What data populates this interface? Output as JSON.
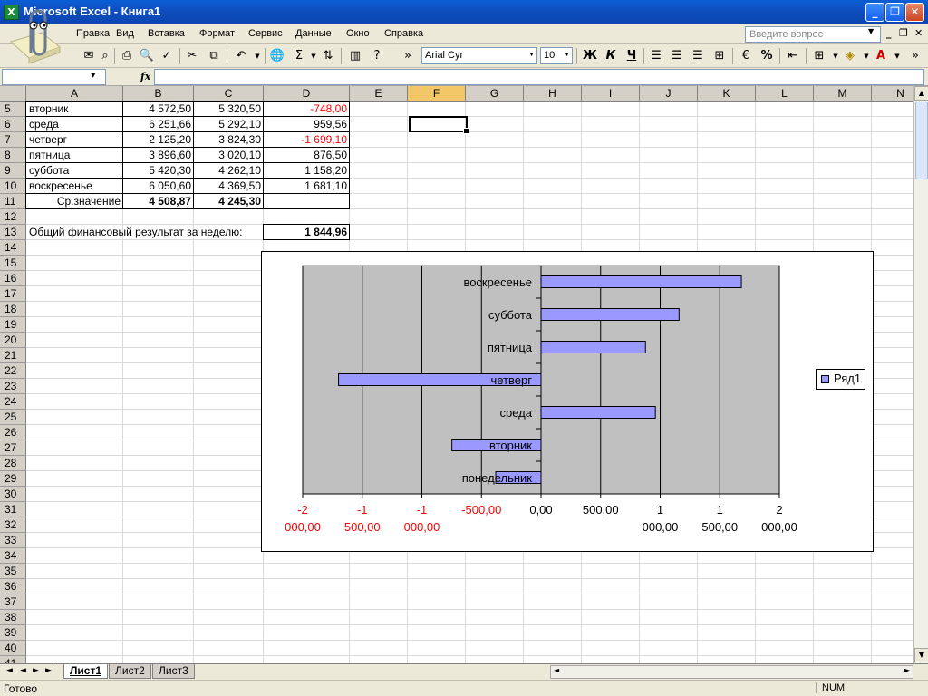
{
  "window": {
    "title": "Microsoft Excel - Книга1",
    "minimize": "_",
    "restore": "❐",
    "close": "✕"
  },
  "menu": {
    "items": [
      "Правка",
      "Вид",
      "Вставка",
      "Формат",
      "Сервис",
      "Данные",
      "Окно",
      "Справка"
    ],
    "ask_placeholder": "Введите вопрос"
  },
  "toolbar": {
    "font": "Arial Cyr",
    "size": "10",
    "bold": "Ж",
    "italic": "К",
    "underline": "Ч",
    "percent": "%"
  },
  "formula_bar": {
    "fx": "fx",
    "name_box": "",
    "content": ""
  },
  "columns": [
    "A",
    "B",
    "C",
    "D",
    "E",
    "F",
    "G",
    "H",
    "I",
    "J",
    "K",
    "L",
    "M",
    "N"
  ],
  "selected_column": "F",
  "rows": [
    "5",
    "6",
    "7",
    "8",
    "9",
    "10",
    "11",
    "12",
    "13",
    "14",
    "15",
    "16",
    "17",
    "18",
    "19",
    "20",
    "21",
    "22",
    "23",
    "24",
    "25",
    "26",
    "27",
    "28",
    "29",
    "30",
    "31",
    "32",
    "33",
    "34",
    "35",
    "36",
    "37",
    "38",
    "39",
    "40",
    "41"
  ],
  "table": [
    {
      "day": "вторник",
      "b": "4 572,50",
      "c": "5 320,50",
      "d": "-748,00",
      "neg": true
    },
    {
      "day": "среда",
      "b": "6 251,66",
      "c": "5 292,10",
      "d": "959,56",
      "neg": false
    },
    {
      "day": "четверг",
      "b": "2 125,20",
      "c": "3 824,30",
      "d": "-1 699,10",
      "neg": true
    },
    {
      "day": "пятница",
      "b": "3 896,60",
      "c": "3 020,10",
      "d": "876,50",
      "neg": false
    },
    {
      "day": "суббота",
      "b": "5 420,30",
      "c": "4 262,10",
      "d": "1 158,20",
      "neg": false
    },
    {
      "day": "воскресенье",
      "b": "6 050,60",
      "c": "4 369,50",
      "d": "1 681,10",
      "neg": false
    }
  ],
  "average": {
    "label": "Ср.значение",
    "b": "4 508,87",
    "c": "4 245,30"
  },
  "total": {
    "label": "Общий финансовый результат за неделю:",
    "value": "1 844,96"
  },
  "chart_data": {
    "type": "bar",
    "orientation": "horizontal",
    "categories": [
      "понедельник",
      "вторник",
      "среда",
      "четверг",
      "пятница",
      "суббота",
      "воскресенье"
    ],
    "series": [
      {
        "name": "Ряд1",
        "values": [
          -380,
          -748.0,
          959.56,
          -1699.1,
          876.5,
          1158.2,
          1681.1
        ]
      }
    ],
    "xlim": [
      -2000,
      2000
    ],
    "x_ticks": [
      -2000,
      -1500,
      -1000,
      -500,
      0,
      500,
      1000,
      1500,
      2000
    ],
    "x_tick_labels": [
      {
        "line1": "-2",
        "line2": "000,00",
        "neg": true
      },
      {
        "line1": "-1",
        "line2": "500,00",
        "neg": true
      },
      {
        "line1": "-1",
        "line2": "000,00",
        "neg": true
      },
      {
        "line1": "-500,00",
        "line2": "",
        "neg": true
      },
      {
        "line1": "0,00",
        "line2": "",
        "neg": false
      },
      {
        "line1": "500,00",
        "line2": "",
        "neg": false
      },
      {
        "line1": "1",
        "line2": "000,00",
        "neg": false
      },
      {
        "line1": "1",
        "line2": "500,00",
        "neg": false
      },
      {
        "line1": "2",
        "line2": "000,00",
        "neg": false
      }
    ],
    "bar_color": "#9999ff",
    "plot_bg": "#c0c0c0",
    "legend": "right",
    "grid": true
  },
  "sheets": {
    "tabs": [
      "Лист1",
      "Лист2",
      "Лист3"
    ],
    "active": "Лист1"
  },
  "status": {
    "text": "Готово",
    "num": "NUM"
  }
}
